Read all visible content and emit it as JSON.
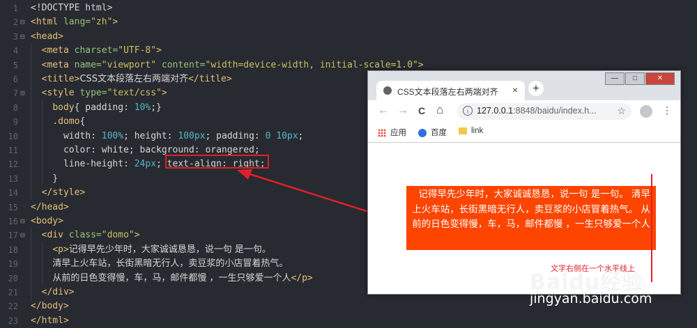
{
  "editor": {
    "lines": [
      {
        "n": "1",
        "fold": "",
        "html": "<span class='kw'>&lt;!DOCTYPE html&gt;</span>"
      },
      {
        "n": "2",
        "fold": "⊟",
        "html": "<span class='tag'>&lt;html</span> <span class='attr'>lang=</span><span class='str'>\"zh\"</span><span class='tag'>&gt;</span>"
      },
      {
        "n": "3",
        "fold": "⊟",
        "html": "<span class='tag'>&lt;head&gt;</span>"
      },
      {
        "n": "4",
        "fold": "",
        "html": "  <span class='tag'>&lt;meta</span> <span class='attr'>charset=</span><span class='str'>\"UTF-8\"</span><span class='tag'>&gt;</span>"
      },
      {
        "n": "5",
        "fold": "",
        "html": "  <span class='tag'>&lt;meta</span> <span class='attr'>name=</span><span class='str'>\"viewport\"</span> <span class='attr'>content=</span><span class='str'>\"width=device-width, initial-scale=1.0\"</span><span class='tag'>&gt;</span>"
      },
      {
        "n": "6",
        "fold": "",
        "html": "  <span class='tag'>&lt;title&gt;</span><span class='txt'>CSS文本段落左右两端对齐</span><span class='tag'>&lt;/title&gt;</span>"
      },
      {
        "n": "7",
        "fold": "⊟",
        "html": "  <span class='tag'>&lt;style</span> <span class='attr'>type=</span><span class='str'>\"text/css\"</span><span class='tag'>&gt;</span>"
      },
      {
        "n": "8",
        "fold": "",
        "html": "    <span class='sel'>body</span>{ padding: <span class='val'>10%</span>;}"
      },
      {
        "n": "9",
        "fold": "",
        "html": "    <span class='sel'>.domo</span>{"
      },
      {
        "n": "10",
        "fold": "",
        "html": "      width: <span class='val'>100%</span>; height: <span class='val'>100px</span>; padding: <span class='val'>0 10px</span>;"
      },
      {
        "n": "11",
        "fold": "",
        "html": "      color: white; background: orangered;"
      },
      {
        "n": "12",
        "fold": "",
        "html": "      line-height: <span class='val'>24px</span>; text-align: right;"
      },
      {
        "n": "13",
        "fold": "",
        "html": "    }"
      },
      {
        "n": "14",
        "fold": "",
        "html": "  <span class='tag'>&lt;/style&gt;</span>"
      },
      {
        "n": "15",
        "fold": "",
        "html": "<span class='tag'>&lt;/head&gt;</span>"
      },
      {
        "n": "16",
        "fold": "⊟",
        "html": "<span class='tag'>&lt;body&gt;</span>"
      },
      {
        "n": "17",
        "fold": "⊟",
        "html": "  <span class='tag'>&lt;div</span> <span class='attr'>class=</span><span class='str'>\"domo\"</span><span class='tag'>&gt;</span>"
      },
      {
        "n": "18",
        "fold": "",
        "html": "    <span class='tag'>&lt;p&gt;</span><span class='txt'>记得早先少年时，大家诚诚恳恳，说一句 是一句。</span>"
      },
      {
        "n": "19",
        "fold": "",
        "html": "    <span class='txt'>清早上火车站，长街黑暗无行人，卖豆浆的小店冒着热气。</span>"
      },
      {
        "n": "20",
        "fold": "",
        "html": "    <span class='txt'>从前的日色变得慢，车，马，邮件都慢 ，一生只够爱一个人</span><span class='tag'>&lt;/p&gt;</span>"
      },
      {
        "n": "21",
        "fold": "",
        "html": "  <span class='tag'>&lt;/div&gt;</span>"
      },
      {
        "n": "22",
        "fold": "",
        "html": "<span class='tag'>&lt;/body&gt;</span>"
      },
      {
        "n": "23",
        "fold": "",
        "html": "<span class='tag'>&lt;/html&gt;</span>"
      }
    ]
  },
  "browser": {
    "tab_title": "CSS文本段落左右两端对齐",
    "tab_close": "×",
    "new_tab": "+",
    "back": "←",
    "forward": "→",
    "reload": "C",
    "home": "⌂",
    "url_host": "127.0.0.1",
    "url_rest": ":8848/baidu/index.h...",
    "star": "☆",
    "menu": "⋮",
    "bookmarks": [
      {
        "label": "应用",
        "icon": "apps-icon"
      },
      {
        "label": "百度",
        "icon": "baidu-paw-icon"
      },
      {
        "label": "link",
        "icon": "folder-icon"
      }
    ],
    "window_controls": {
      "minimize": "—",
      "maximize": "□",
      "close": "✕"
    },
    "page_text": "记得早先少年时，大家诚诚恳恳，说一句 是一句。 清早上火车站，长街黑暗无行人，卖豆浆的小店冒着热气。 从前的日色变得慢，车，马，邮件都慢 ，一生只够爱一个人",
    "caption": "文字右侧在一个水平线上"
  },
  "watermark": {
    "brand": "Baidu经验",
    "url": "jingyan.baidu.com"
  },
  "colors": {
    "editor_bg": "#272a30",
    "highlight": "#e0202a",
    "domo_bg": "#fd4500"
  }
}
